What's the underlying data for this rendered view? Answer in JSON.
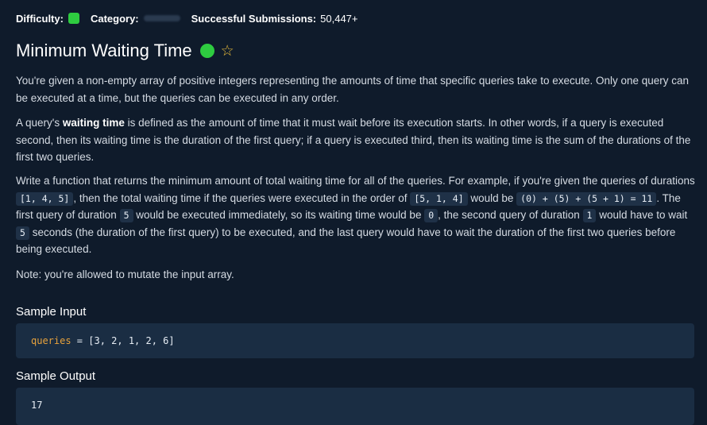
{
  "meta": {
    "difficulty_label": "Difficulty:",
    "difficulty_color": "#2ecc40",
    "category_label": "Category:",
    "submissions_label": "Successful Submissions:",
    "submissions_value": "50,447+"
  },
  "question": {
    "title": "Minimum Waiting Time",
    "status_color": "#2ecc40",
    "star_icon": "star-outline-icon"
  },
  "prose": {
    "p1": "You're given a non-empty array of positive integers representing the amounts of time that specific queries take to execute. Only one query can be executed at a time, but the queries can be executed in any order.",
    "p2_a": "A query's ",
    "p2_bold": "waiting time",
    "p2_b": " is defined as the amount of time that it must wait before its execution starts. In other words, if a query is executed second, then its waiting time is the duration of the first query; if a query is executed third, then its waiting time is the sum of the durations of the first two queries.",
    "p3_a": "Write a function that returns the minimum amount of total waiting time for all of the queries. For example, if you're given the queries of durations ",
    "p3_code1": "[1, 4, 5]",
    "p3_b": ", then the total waiting time if the queries were executed in the order of ",
    "p3_code2": "[5, 1, 4]",
    "p3_c": " would be ",
    "p3_code3": "(0) + (5) + (5 + 1) = 11",
    "p3_d": ". The first query of duration ",
    "p3_code4": "5",
    "p3_e": " would be executed immediately, so its waiting time would be ",
    "p3_code5": "0",
    "p3_f": ", the second query of duration ",
    "p3_code6": "1",
    "p3_g": " would have to wait ",
    "p3_code7": "5",
    "p3_h": " seconds (the duration of the first query) to be executed, and the last query would have to wait the duration of the first two queries before being executed.",
    "p4": "Note: you're allowed to mutate the input array."
  },
  "sample_input": {
    "title": "Sample Input",
    "var_name": "queries",
    "rest": " = [3, 2, 1, 2, 6]"
  },
  "sample_output": {
    "title": "Sample Output",
    "value": "17"
  }
}
